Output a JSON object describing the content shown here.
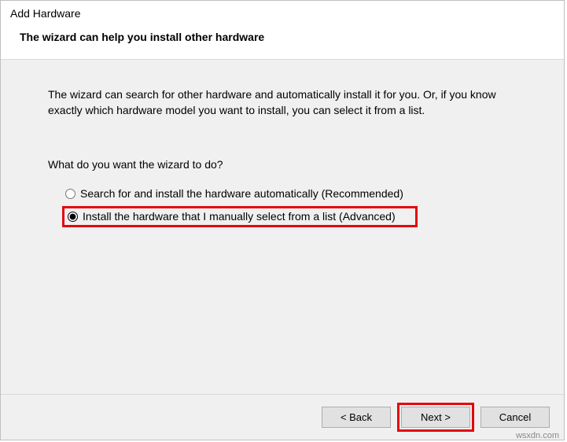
{
  "window": {
    "title": "Add Hardware",
    "subtitle": "The wizard can help you install other hardware"
  },
  "body": {
    "intro": "The wizard can search for other hardware and automatically install it for you. Or, if you know exactly which hardware model you want to install, you can select it from a list.",
    "question": "What do you want the wizard to do?",
    "options": [
      {
        "label": "Search for and install the hardware automatically (Recommended)",
        "selected": false
      },
      {
        "label": "Install the hardware that I manually select from a list (Advanced)",
        "selected": true
      }
    ]
  },
  "footer": {
    "back": "< Back",
    "next": "Next >",
    "cancel": "Cancel"
  },
  "watermark": "wsxdn.com"
}
